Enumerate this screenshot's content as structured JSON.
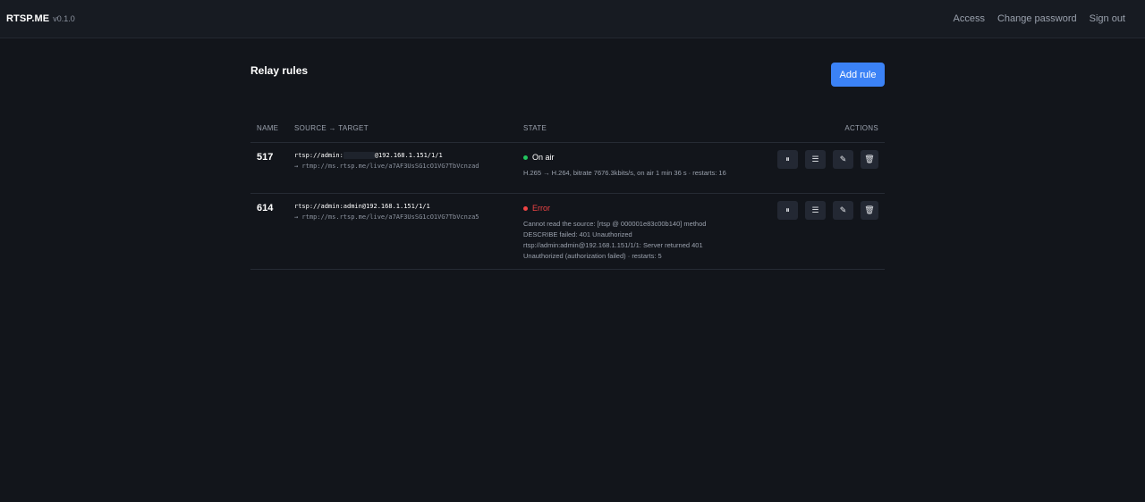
{
  "header": {
    "brand": "RTSP.ME",
    "version": "v0.1.0",
    "nav": [
      "Access",
      "Change password",
      "Sign out"
    ]
  },
  "page": {
    "title": "Relay rules",
    "add_button": "Add rule"
  },
  "table": {
    "columns": [
      "NAME",
      "SOURCE → TARGET",
      "STATE",
      "ACTIONS"
    ],
    "rows": [
      {
        "name": "517",
        "source_prefix": "rtsp://admin:",
        "source_suffix": "@192.168.1.151/1/1",
        "target": "→ rtmp://ms.rtsp.me/live/a7AF3UsSG1cO1VG7TbVcnzad",
        "state": "On air",
        "state_color": "#22c55e",
        "detail": "H.265 → H.264, bitrate 7676.3kbits/s, on air 1 min 36 s · restarts: 16"
      },
      {
        "name": "614",
        "source_prefix": "rtsp://admin:admin@192.168.1.151/1/1",
        "source_suffix": "",
        "target": "→ rtmp://ms.rtsp.me/live/a7AF3UsSG1cO1VG7TbVcnza5",
        "state": "Error",
        "state_color": "#ef4444",
        "detail": "Cannot read the source: [rtsp @ 000001e83c00b140] method DESCRIBE failed: 401 Unauthorized rtsp://admin:admin@192.168.1.151/1/1: Server returned 401 Unauthorized (authorization failed) · restarts: 5"
      }
    ],
    "action_icons": [
      "pause-icon",
      "logs-icon",
      "edit-icon",
      "delete-icon"
    ],
    "action_glyphs": [
      "⏸",
      "☰",
      "✎",
      "🗑"
    ]
  }
}
